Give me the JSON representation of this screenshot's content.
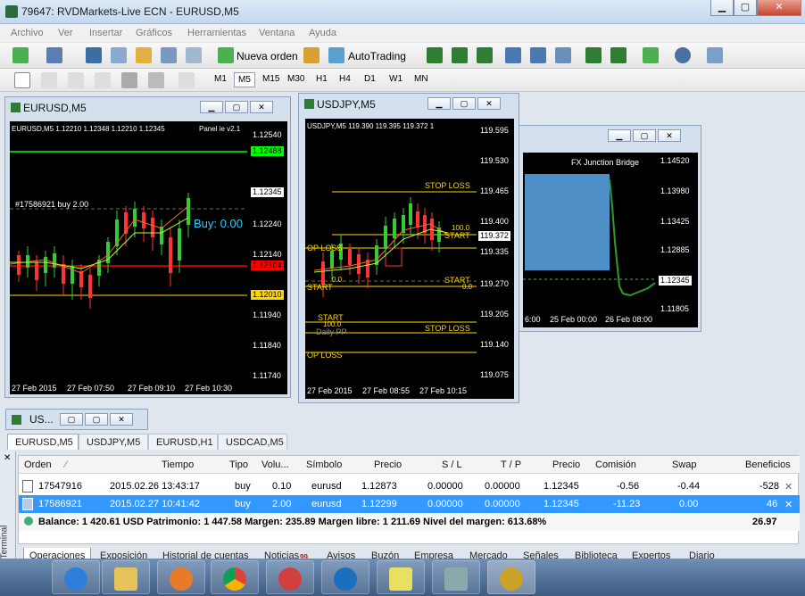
{
  "window": {
    "title": "79647: RVDMarkets-Live ECN - EURUSD,M5"
  },
  "menu": [
    "Archivo",
    "Ver",
    "Insertar",
    "Gráficos",
    "Herramientas",
    "Ventana",
    "Ayuda"
  ],
  "toolbar": {
    "new_order": "Nueva orden",
    "autotrading": "AutoTrading"
  },
  "timeframes": [
    "M1",
    "M5",
    "M15",
    "M30",
    "H1",
    "H4",
    "D1",
    "W1",
    "MN"
  ],
  "charts": {
    "eurusd": {
      "title": "EURUSD,M5",
      "info": "EURUSD,M5  1.12210 1.12348 1.12210 1.12345",
      "indicator": "Panel ie v2.1",
      "trade_label": "#17586921 buy 2.00",
      "buy_label": "Buy: 0.00",
      "prices": [
        "1.12540",
        "1.12440",
        "1.12345",
        "1.12240",
        "1.12140",
        "1.12040",
        "1.11940",
        "1.11840",
        "1.11740"
      ],
      "marks": {
        "green": "1.12488",
        "cur": "1.12345",
        "red": "1.12104",
        "yellow": "1.12010"
      },
      "times": [
        "27 Feb 2015",
        "27 Feb 07:50",
        "27 Feb 09:10",
        "27 Feb 10:30"
      ]
    },
    "usdjpy": {
      "title": "USDJPY,M5",
      "info": "USDJPY,M5  119.390 119.395 119.372 1",
      "prices": [
        "119.595",
        "119.530",
        "119.465",
        "119.400",
        "119.335",
        "119.270",
        "119.205",
        "119.140",
        "119.075"
      ],
      "cur": "119.372",
      "labels": [
        "STOP LOSS",
        "STOP LOSS",
        "OP LOSS",
        "START",
        "START",
        "OP LOSS",
        "START",
        "START",
        "Daily PP",
        "100.0",
        "0.0",
        "0.0",
        "100.0"
      ],
      "times": [
        "27 Feb 2015",
        "27 Feb 08:55",
        "27 Feb 10:15"
      ]
    },
    "third": {
      "indicator": "FX Junction Bridge",
      "prices": [
        "1.14520",
        "1.13980",
        "1.13425",
        "1.12885",
        "1.12345",
        "1.11805"
      ],
      "times": [
        "6:00",
        "25 Feb 00:00",
        "26 Feb 08:00"
      ]
    }
  },
  "terminal": {
    "title": "US...",
    "sidebar": "Terminal",
    "chart_tabs": [
      "EURUSD,M5",
      "USDJPY,M5",
      "EURUSD,H1",
      "USDCAD,M5"
    ],
    "columns": [
      "Orden",
      "Tiempo",
      "Tipo",
      "Volu...",
      "Símbolo",
      "Precio",
      "S / L",
      "T / P",
      "Precio",
      "Comisión",
      "Swap",
      "Beneficios"
    ],
    "rows": [
      [
        "17547916",
        "2015.02.26 13:43:17",
        "buy",
        "0.10",
        "eurusd",
        "1.12873",
        "0.00000",
        "0.00000",
        "1.12345",
        "-0.56",
        "-0.44",
        "-528"
      ],
      [
        "17586921",
        "2015.02.27 10:41:42",
        "buy",
        "2.00",
        "eurusd",
        "1.12299",
        "0.00000",
        "0.00000",
        "1.12345",
        "-11.23",
        "0.00",
        "46"
      ]
    ],
    "balance": "Balance: 1 420.61 USD  Patrimonio: 1 447.58  Margen: 235.89  Margen libre: 1 211.69  Nivel del margen: 613.68%",
    "total": "26.97",
    "bottom_tabs": [
      "Operaciones",
      "Exposición",
      "Historial de cuentas",
      "Noticias",
      "Avisos",
      "Buzón",
      "Empresa",
      "Mercado",
      "Señales",
      "Biblioteca",
      "Expertos",
      "Diario"
    ],
    "news_badge": "99"
  },
  "colors": {
    "buy": "#33ccff",
    "sl": "#ffd700",
    "green": "#00ff00",
    "red": "#ff0000",
    "selected": "#3399ff"
  }
}
